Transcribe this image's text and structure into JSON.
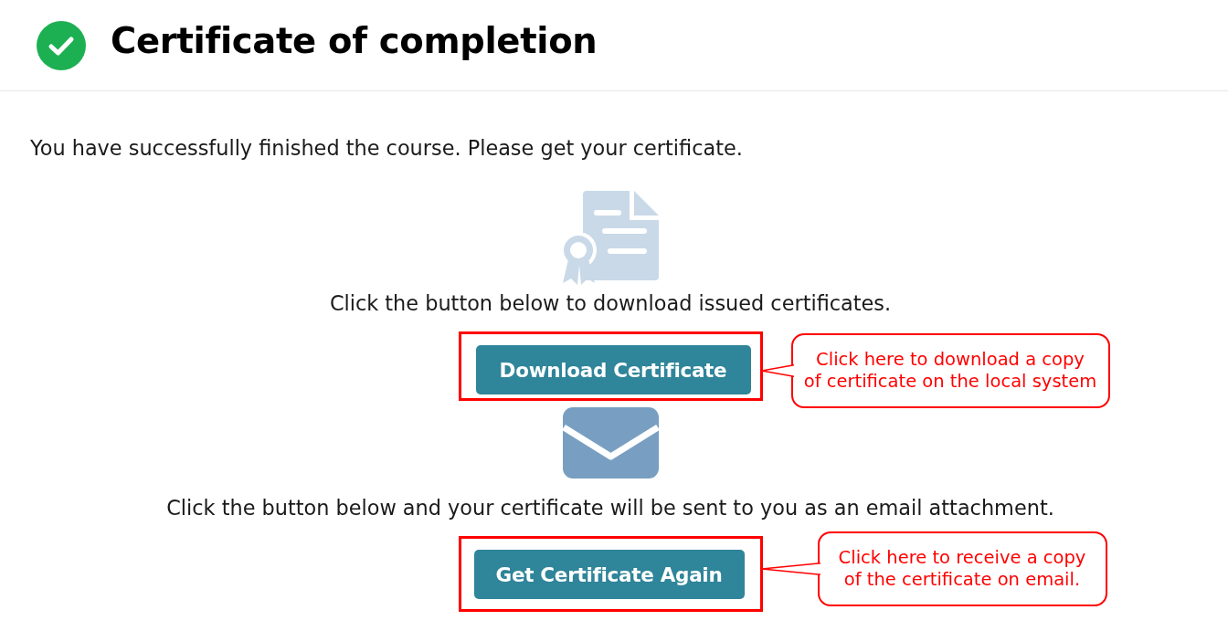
{
  "header": {
    "title": "Certificate of completion"
  },
  "intro": "You have successfully finished the course. Please get your certificate.",
  "sections": [
    {
      "kind": "certificate",
      "message": "Click the button below to download issued certificates.",
      "button": "Download Certificate",
      "highlighted": true,
      "callout": [
        "Click here to download a copy",
        "of certificate on the local system"
      ]
    },
    {
      "kind": "email",
      "message": "Click the button below and your certificate will be sent to you as an email attachment.",
      "button": "Get Certificate Again",
      "highlighted": true,
      "callout": [
        "Click here to receive a copy",
        "of the certificate on email."
      ]
    }
  ]
}
